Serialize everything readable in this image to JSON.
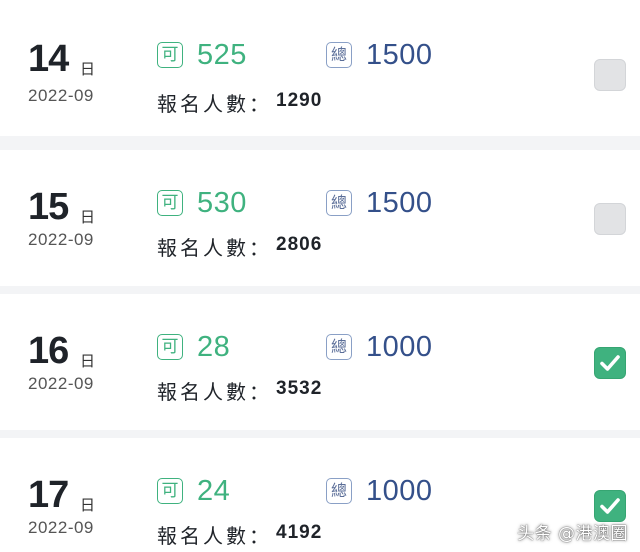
{
  "labels": {
    "day_unit": "日",
    "available_badge": "可",
    "total_badge": "總",
    "registered_label": "報名人數："
  },
  "colors": {
    "available": "#3fb27f",
    "total": "#34508a",
    "checked": "#3fb27f",
    "unchecked": "#e2e3e5"
  },
  "sessions": [
    {
      "day": "14",
      "year_month": "2022-09",
      "available": "525",
      "total": "1500",
      "registered": "1290",
      "selected": false
    },
    {
      "day": "15",
      "year_month": "2022-09",
      "available": "530",
      "total": "1500",
      "registered": "2806",
      "selected": false
    },
    {
      "day": "16",
      "year_month": "2022-09",
      "available": "28",
      "total": "1000",
      "registered": "3532",
      "selected": true
    },
    {
      "day": "17",
      "year_month": "2022-09",
      "available": "24",
      "total": "1000",
      "registered": "4192",
      "selected": true
    }
  ],
  "watermark": "头条 @港澳圈"
}
